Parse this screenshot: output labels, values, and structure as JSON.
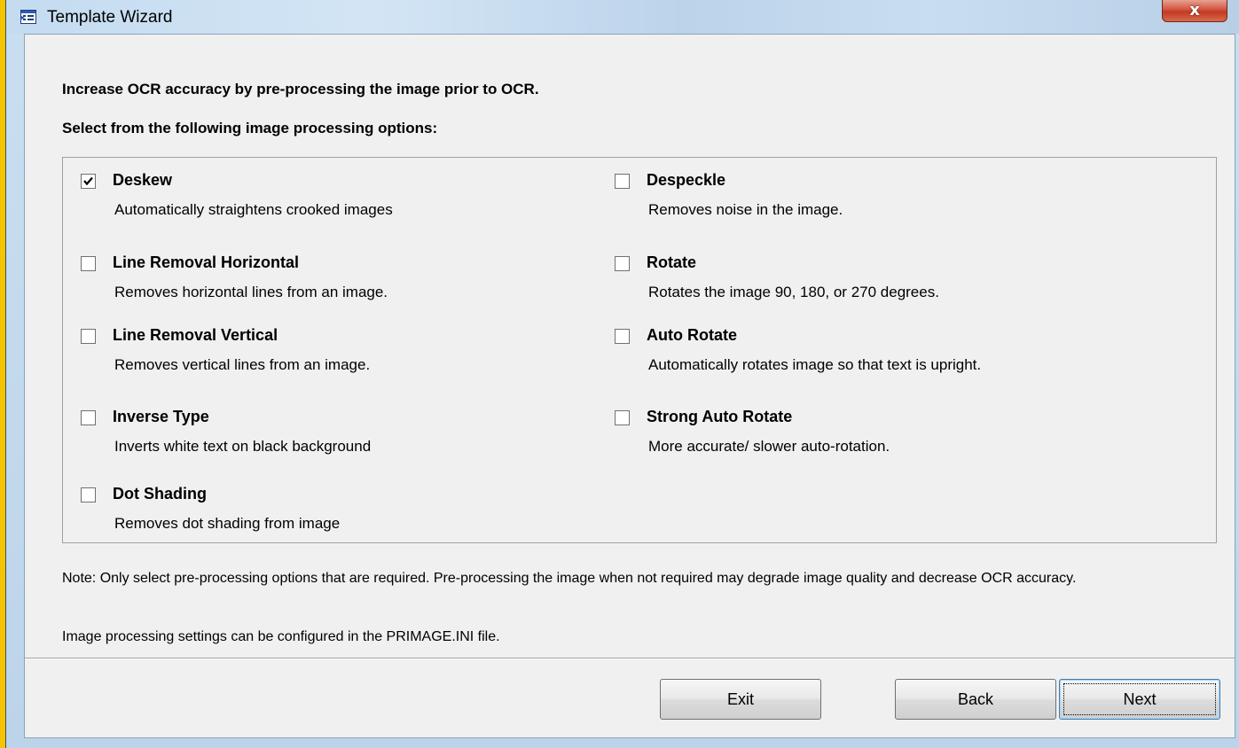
{
  "window": {
    "title": "Template Wizard",
    "close_label": "x"
  },
  "intro": {
    "line1": "Increase OCR accuracy by pre-processing the image prior to OCR.",
    "line2": "Select from the following image processing options:"
  },
  "options": [
    {
      "label": "Deskew",
      "description": "Automatically straightens crooked images",
      "checked": true
    },
    {
      "label": "Despeckle",
      "description": "Removes noise in the image.",
      "checked": false
    },
    {
      "label": "Line Removal Horizontal",
      "description": "Removes horizontal lines from an image.",
      "checked": false
    },
    {
      "label": "Rotate",
      "description": "Rotates the image 90, 180, or 270 degrees.",
      "checked": false
    },
    {
      "label": "Line Removal Vertical",
      "description": "Removes vertical lines from an image.",
      "checked": false
    },
    {
      "label": "Auto Rotate",
      "description": "Automatically rotates image so that text is upright.",
      "checked": false
    },
    {
      "label": "Inverse Type",
      "description": "Inverts  white text on black background",
      "checked": false
    },
    {
      "label": "Strong Auto Rotate",
      "description": "More accurate/ slower auto-rotation.",
      "checked": false
    },
    {
      "label": "Dot Shading",
      "description": "Removes dot shading from image",
      "checked": false
    }
  ],
  "notes": {
    "note1": "Note:  Only select pre-processing options that are required.  Pre-processing the image when not required may degrade image quality and decrease OCR accuracy.",
    "note2": "Image processing settings can be configured in the PRIMAGE.INI file."
  },
  "buttons": {
    "exit": "Exit",
    "back": "Back",
    "next": "Next"
  },
  "icons": {
    "title_icon": "template-wizard-icon",
    "close_icon": "close-icon",
    "check_icon": "checkmark-icon"
  },
  "colors": {
    "background": "#f5c400",
    "dialog": "#f0f0f0",
    "close_button": "#c13a22",
    "focus_border": "#3c7fb1"
  }
}
